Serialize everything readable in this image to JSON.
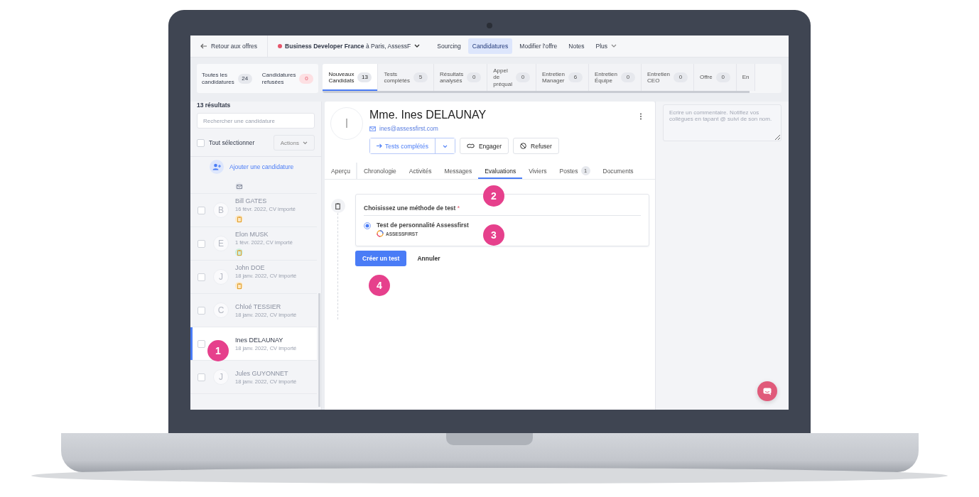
{
  "nav": {
    "back": "Retour aux offres",
    "job": "**Business Developer France** à Paris, AssessF",
    "items": [
      {
        "label": "Sourcing",
        "selected": false,
        "dropdown": false
      },
      {
        "label": "Candidatures",
        "selected": true,
        "dropdown": false
      },
      {
        "label": "Modifier l'offre",
        "selected": false,
        "dropdown": false
      },
      {
        "label": "Notes",
        "selected": false,
        "dropdown": false
      },
      {
        "label": "Plus",
        "selected": false,
        "dropdown": true
      }
    ]
  },
  "summary_stages": [
    {
      "lines": [
        "Toutes les",
        "candidatures"
      ],
      "count": "24",
      "alert": false
    },
    {
      "lines": [
        "Candidatures",
        "refusées"
      ],
      "count": "0",
      "alert": true
    }
  ],
  "stages": [
    {
      "lines": [
        "Nouveaux",
        "Candidats"
      ],
      "count": "13",
      "selected": true
    },
    {
      "lines": [
        "Tests",
        "complétés"
      ],
      "count": "5",
      "selected": false
    },
    {
      "lines": [
        "Résultats",
        "analysés"
      ],
      "count": "0",
      "selected": false
    },
    {
      "lines": [
        "Appel",
        "de",
        "préqual"
      ],
      "count": "0",
      "selected": false
    },
    {
      "lines": [
        "Entretien",
        "Manager"
      ],
      "count": "6",
      "selected": false
    },
    {
      "lines": [
        "Entretien",
        "Équipe"
      ],
      "count": "0",
      "selected": false
    },
    {
      "lines": [
        "Entretien",
        "CEO"
      ],
      "count": "0",
      "selected": false
    },
    {
      "lines": [
        "Offre"
      ],
      "count": "0",
      "selected": false
    },
    {
      "lines": [
        "En"
      ],
      "selected": false
    }
  ],
  "sidebar": {
    "results": "13 résultats",
    "search": {
      "placeholder": "Rechercher une candidature"
    },
    "select_all": {
      "label": "Tout sélectionner",
      "checked": false
    },
    "actions": "Actions",
    "add": "Ajouter une candidature",
    "candidates": [
      {
        "partial": true,
        "tag": {
          "kind": "mail",
          "color": "#e6e8ee"
        },
        "selected": false
      },
      {
        "initial": "B",
        "name": "Bill GATES",
        "meta": "16 févr. 2022, CV importé",
        "tag": {
          "kind": "clipboard",
          "color": "#fde8c4"
        },
        "selected": false,
        "checked": false
      },
      {
        "initial": "E",
        "name": "Elon MUSK",
        "meta": "1 févr. 2022, CV importé",
        "tag": {
          "kind": "clipboard",
          "color": "#cdeee0"
        },
        "selected": false,
        "checked": false
      },
      {
        "initial": "J",
        "name": "John DOE",
        "meta": "18 janv. 2022, CV importé",
        "tag": {
          "kind": "clipboard",
          "color": "#fde8c4"
        },
        "selected": false,
        "checked": false
      },
      {
        "initial": "C",
        "name": "Chloé TESSIER",
        "meta": "18 janv. 2022, CV importé",
        "selected": false,
        "checked": false
      },
      {
        "name": "Ines DELAUNAY",
        "meta": "18 janv. 2022, CV importé",
        "selected": true,
        "checked": false
      },
      {
        "initial": "J",
        "name": "Jules GUYONNET",
        "meta": "18 janv. 2022, CV importé",
        "selected": false,
        "checked": false
      }
    ]
  },
  "profile": {
    "initial": "I",
    "name": "Mme. Ines DELAUNAY",
    "email": "ines@assessfirst.com",
    "status_button": "Tests complétés",
    "engage": "Engager",
    "refuse": "Refuser",
    "tabs": [
      {
        "label": "Aperçu",
        "selected": false
      },
      {
        "label": "Chronologie",
        "selected": false
      },
      {
        "label": "Activités",
        "selected": false
      },
      {
        "label": "Messages",
        "selected": false
      },
      {
        "label": "Evaluations",
        "selected": true
      },
      {
        "label": "Viviers",
        "selected": false
      },
      {
        "label": "Postes",
        "badge": "1",
        "selected": false
      },
      {
        "label": "Documents",
        "selected": false
      }
    ]
  },
  "test_form": {
    "label": "Choisissez une méthode de test",
    "required_mark": "*",
    "options": [
      {
        "label": "Test de personnalité Assessfirst",
        "logo": "ASSESSFIRST",
        "selected": true
      }
    ],
    "create": "Créer un test",
    "cancel": "Annuler"
  },
  "comment": {
    "placeholder": "Ecrire un commentaire. Notifiez vos collègues en tapant @ suivi de son nom."
  },
  "annotations": [
    {
      "label": "1"
    },
    {
      "label": "2"
    },
    {
      "label": "3"
    },
    {
      "label": "4"
    }
  ]
}
